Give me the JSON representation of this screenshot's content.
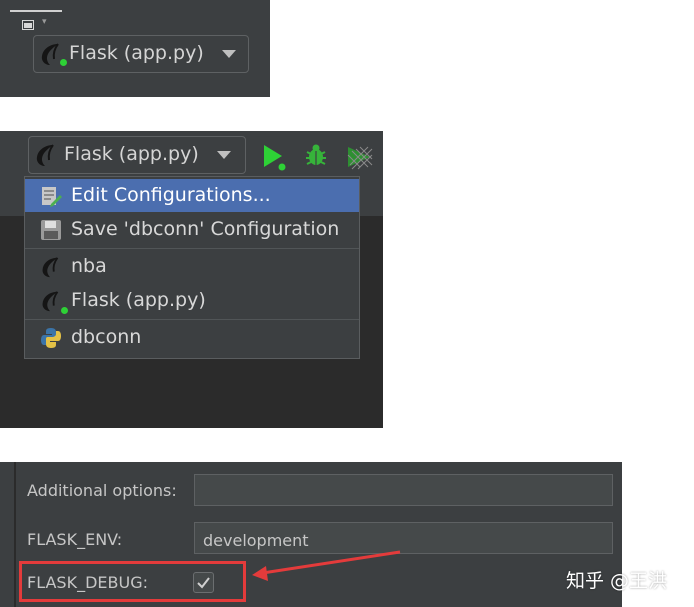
{
  "panel1": {
    "run_config": {
      "label": "Flask (app.py)",
      "icon": "flask-horn-icon",
      "status_color": "#2ed136"
    }
  },
  "panel2": {
    "run_config": {
      "label": "Flask (app.py)",
      "icon": "flask-horn-icon"
    },
    "toolbar": {
      "run_icon": "run-icon",
      "debug_icon": "debug-icon",
      "coverage_icon": "coverage-icon",
      "run_color": "#2ed136"
    },
    "dropdown": {
      "items": [
        {
          "label": "Edit Configurations...",
          "icon": "edit-config-icon",
          "selected": true
        },
        {
          "label": "Save 'dbconn' Configuration",
          "icon": "save-icon"
        },
        {
          "label": "nba",
          "icon": "flask-horn-icon"
        },
        {
          "label": "Flask (app.py)",
          "icon": "flask-horn-icon"
        },
        {
          "label": "dbconn",
          "icon": "python-icon"
        }
      ],
      "selected_color": "#4b6eaf"
    }
  },
  "panel3": {
    "fields": [
      {
        "label": "Additional options:",
        "value": ""
      },
      {
        "label": "FLASK_ENV:",
        "value": "development"
      },
      {
        "label": "FLASK_DEBUG:",
        "checked": true
      }
    ],
    "highlight_color": "#e43b3b"
  },
  "watermark": "知乎 @王洪"
}
